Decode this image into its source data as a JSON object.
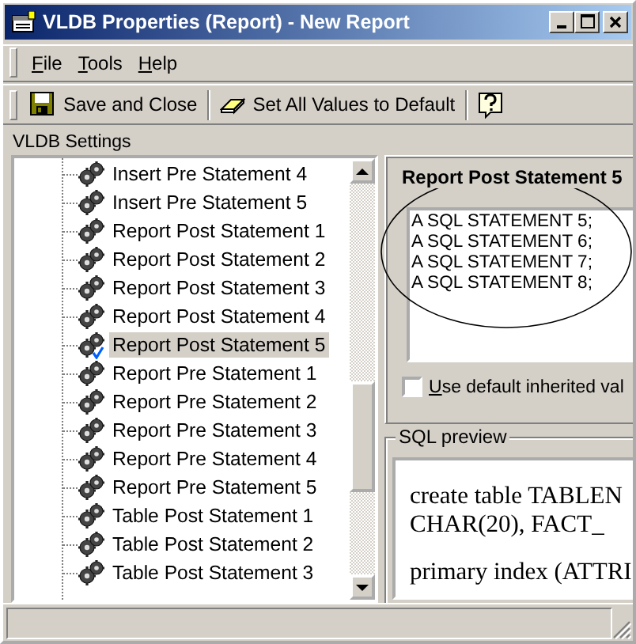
{
  "window": {
    "title": "VLDB Properties (Report) - New Report"
  },
  "menu": [
    "File",
    "Tools",
    "Help"
  ],
  "toolbar": [
    {
      "kind": "save",
      "label": "Save and Close"
    },
    {
      "kind": "eraser",
      "label": "Set All Values to Default"
    },
    {
      "kind": "help"
    }
  ],
  "tree": {
    "label": "VLDB Settings",
    "items": [
      {
        "label": "Insert Pre Statement 4",
        "selected": false,
        "modified": false
      },
      {
        "label": "Insert Pre Statement 5",
        "selected": false,
        "modified": false
      },
      {
        "label": "Report Post Statement 1",
        "selected": false,
        "modified": false
      },
      {
        "label": "Report Post Statement 2",
        "selected": false,
        "modified": false
      },
      {
        "label": "Report Post Statement 3",
        "selected": false,
        "modified": false
      },
      {
        "label": "Report Post Statement 4",
        "selected": false,
        "modified": false
      },
      {
        "label": "Report Post Statement 5",
        "selected": true,
        "modified": true
      },
      {
        "label": "Report Pre Statement 1",
        "selected": false,
        "modified": false
      },
      {
        "label": "Report Pre Statement 2",
        "selected": false,
        "modified": false
      },
      {
        "label": "Report Pre Statement 3",
        "selected": false,
        "modified": false
      },
      {
        "label": "Report Pre Statement 4",
        "selected": false,
        "modified": false
      },
      {
        "label": "Report Pre Statement 5",
        "selected": false,
        "modified": false
      },
      {
        "label": "Table Post Statement 1",
        "selected": false,
        "modified": false
      },
      {
        "label": "Table Post Statement 2",
        "selected": false,
        "modified": false
      },
      {
        "label": "Table Post Statement 3",
        "selected": false,
        "modified": false
      }
    ]
  },
  "setting": {
    "title": "Report Post Statement 5",
    "value": "A SQL STATEMENT 5;\nA SQL STATEMENT 6;\nA SQL STATEMENT 7;\nA SQL STATEMENT 8;",
    "use_default": {
      "label": "Use default inherited val",
      "checked": false
    }
  },
  "sql_preview": {
    "label": "SQL preview",
    "lines": [
      "create table TABLEN",
      "CHAR(20), FACT_",
      "primary index (ATTRI"
    ]
  }
}
